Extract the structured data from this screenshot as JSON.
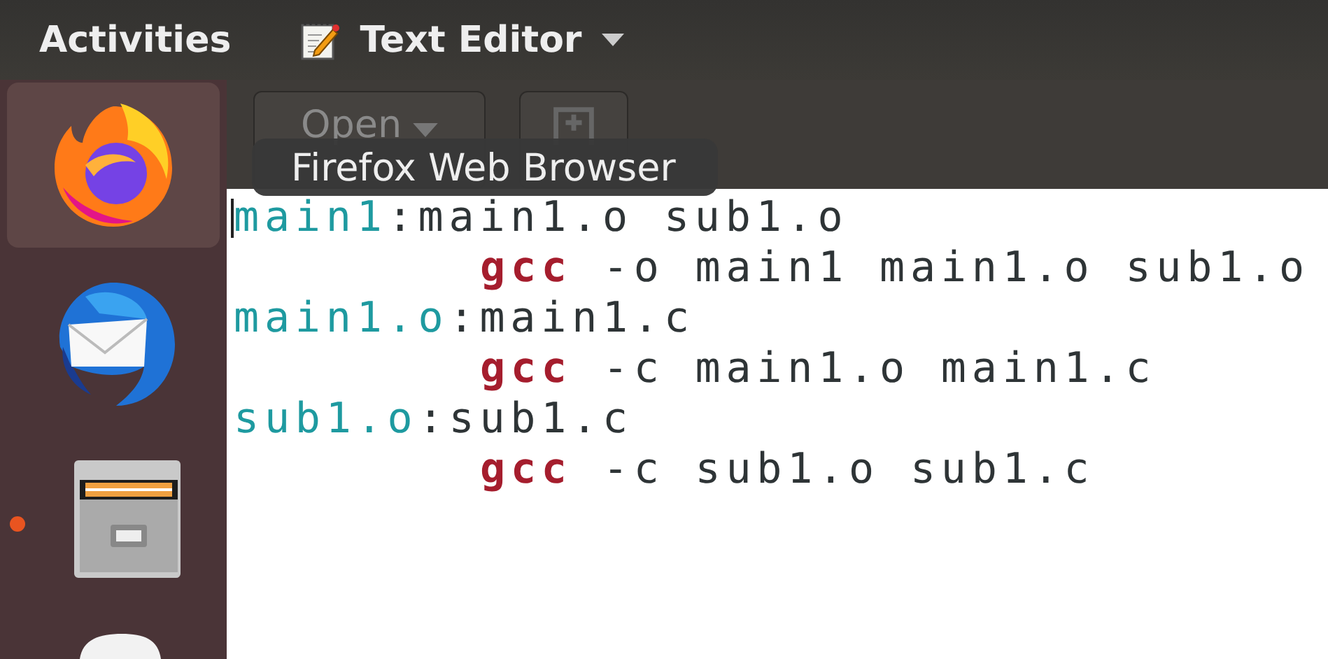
{
  "top_bar": {
    "activities": "Activities",
    "app_menu": {
      "label": "Text Editor"
    }
  },
  "dock": [
    {
      "selected": true,
      "running": false
    },
    {
      "selected": false,
      "running": false
    },
    {
      "selected": false,
      "running": true
    },
    {
      "selected": false,
      "running": false
    }
  ],
  "toolbar": {
    "open_button": "Open"
  },
  "tooltip": "Firefox Web Browser",
  "editor_lines": [
    {
      "indented": false,
      "segments": [
        {
          "kind": "target",
          "text": "main1"
        },
        {
          "kind": "plain",
          "text": ":main1.o sub1.o"
        }
      ]
    },
    {
      "indented": true,
      "segments": [
        {
          "kind": "keyword",
          "text": "gcc"
        },
        {
          "kind": "plain",
          "text": " -o main1 main1.o sub1.o"
        }
      ]
    },
    {
      "indented": false,
      "segments": [
        {
          "kind": "target",
          "text": "main1.o"
        },
        {
          "kind": "plain",
          "text": ":main1.c"
        }
      ]
    },
    {
      "indented": true,
      "segments": [
        {
          "kind": "keyword",
          "text": "gcc"
        },
        {
          "kind": "plain",
          "text": " -c main1.o main1.c"
        }
      ]
    },
    {
      "indented": false,
      "segments": [
        {
          "kind": "target",
          "text": "sub1.o"
        },
        {
          "kind": "plain",
          "text": ":sub1.c"
        }
      ]
    },
    {
      "indented": true,
      "segments": [
        {
          "kind": "keyword",
          "text": "gcc"
        },
        {
          "kind": "plain",
          "text": " -c sub1.o sub1.c"
        }
      ]
    }
  ]
}
